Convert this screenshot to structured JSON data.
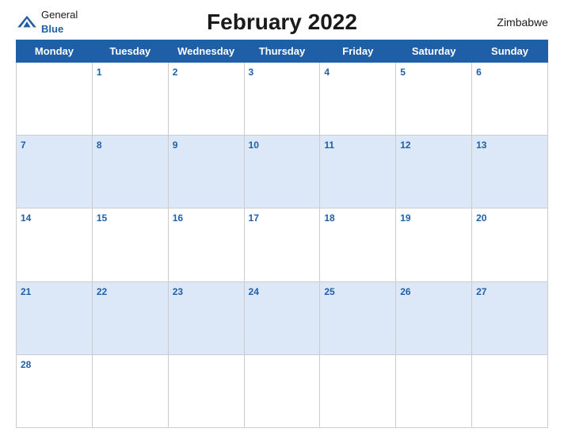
{
  "header": {
    "logo": {
      "general": "General",
      "blue": "Blue",
      "icon_label": "general-blue-logo"
    },
    "title": "February 2022",
    "country": "Zimbabwe"
  },
  "calendar": {
    "days_of_week": [
      "Monday",
      "Tuesday",
      "Wednesday",
      "Thursday",
      "Friday",
      "Saturday",
      "Sunday"
    ],
    "weeks": [
      [
        null,
        1,
        2,
        3,
        4,
        5,
        6
      ],
      [
        7,
        8,
        9,
        10,
        11,
        12,
        13
      ],
      [
        14,
        15,
        16,
        17,
        18,
        19,
        20
      ],
      [
        21,
        22,
        23,
        24,
        25,
        26,
        27
      ],
      [
        28,
        null,
        null,
        null,
        null,
        null,
        null
      ]
    ]
  }
}
